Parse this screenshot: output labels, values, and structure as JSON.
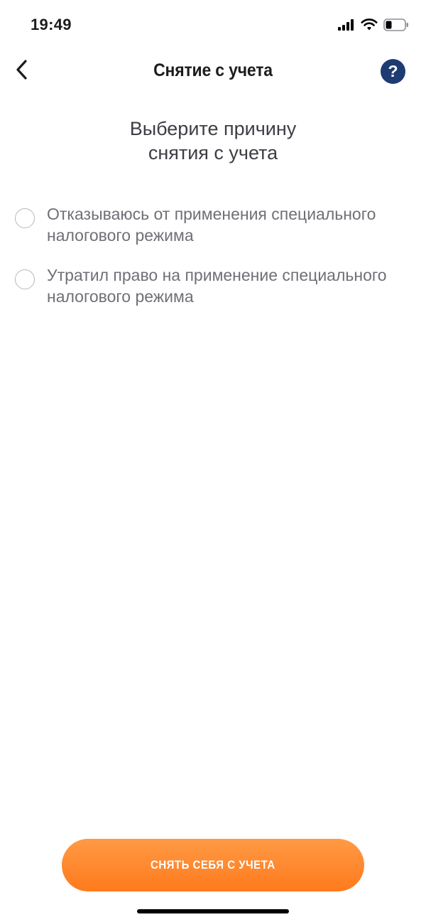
{
  "status_bar": {
    "time": "19:49",
    "icons": [
      "cellular-signal-icon",
      "wifi-icon",
      "battery-icon"
    ]
  },
  "nav": {
    "back_icon": "chevron-left-icon",
    "title": "Снятие с учета",
    "help_label": "?"
  },
  "prompt": {
    "line1": "Выберите причину",
    "line2": "снятия с учета"
  },
  "options": [
    {
      "label": "Отказываюсь от применения специального налогового режима",
      "selected": false
    },
    {
      "label": "Утратил право на применение специального налогового режима",
      "selected": false
    }
  ],
  "primary_action": {
    "label": "СНЯТЬ СЕБЯ С УЧЕТА"
  },
  "colors": {
    "accent_orange": "#ff7a1c",
    "help_navy": "#1f3b73",
    "option_text": "#6f6f76"
  }
}
